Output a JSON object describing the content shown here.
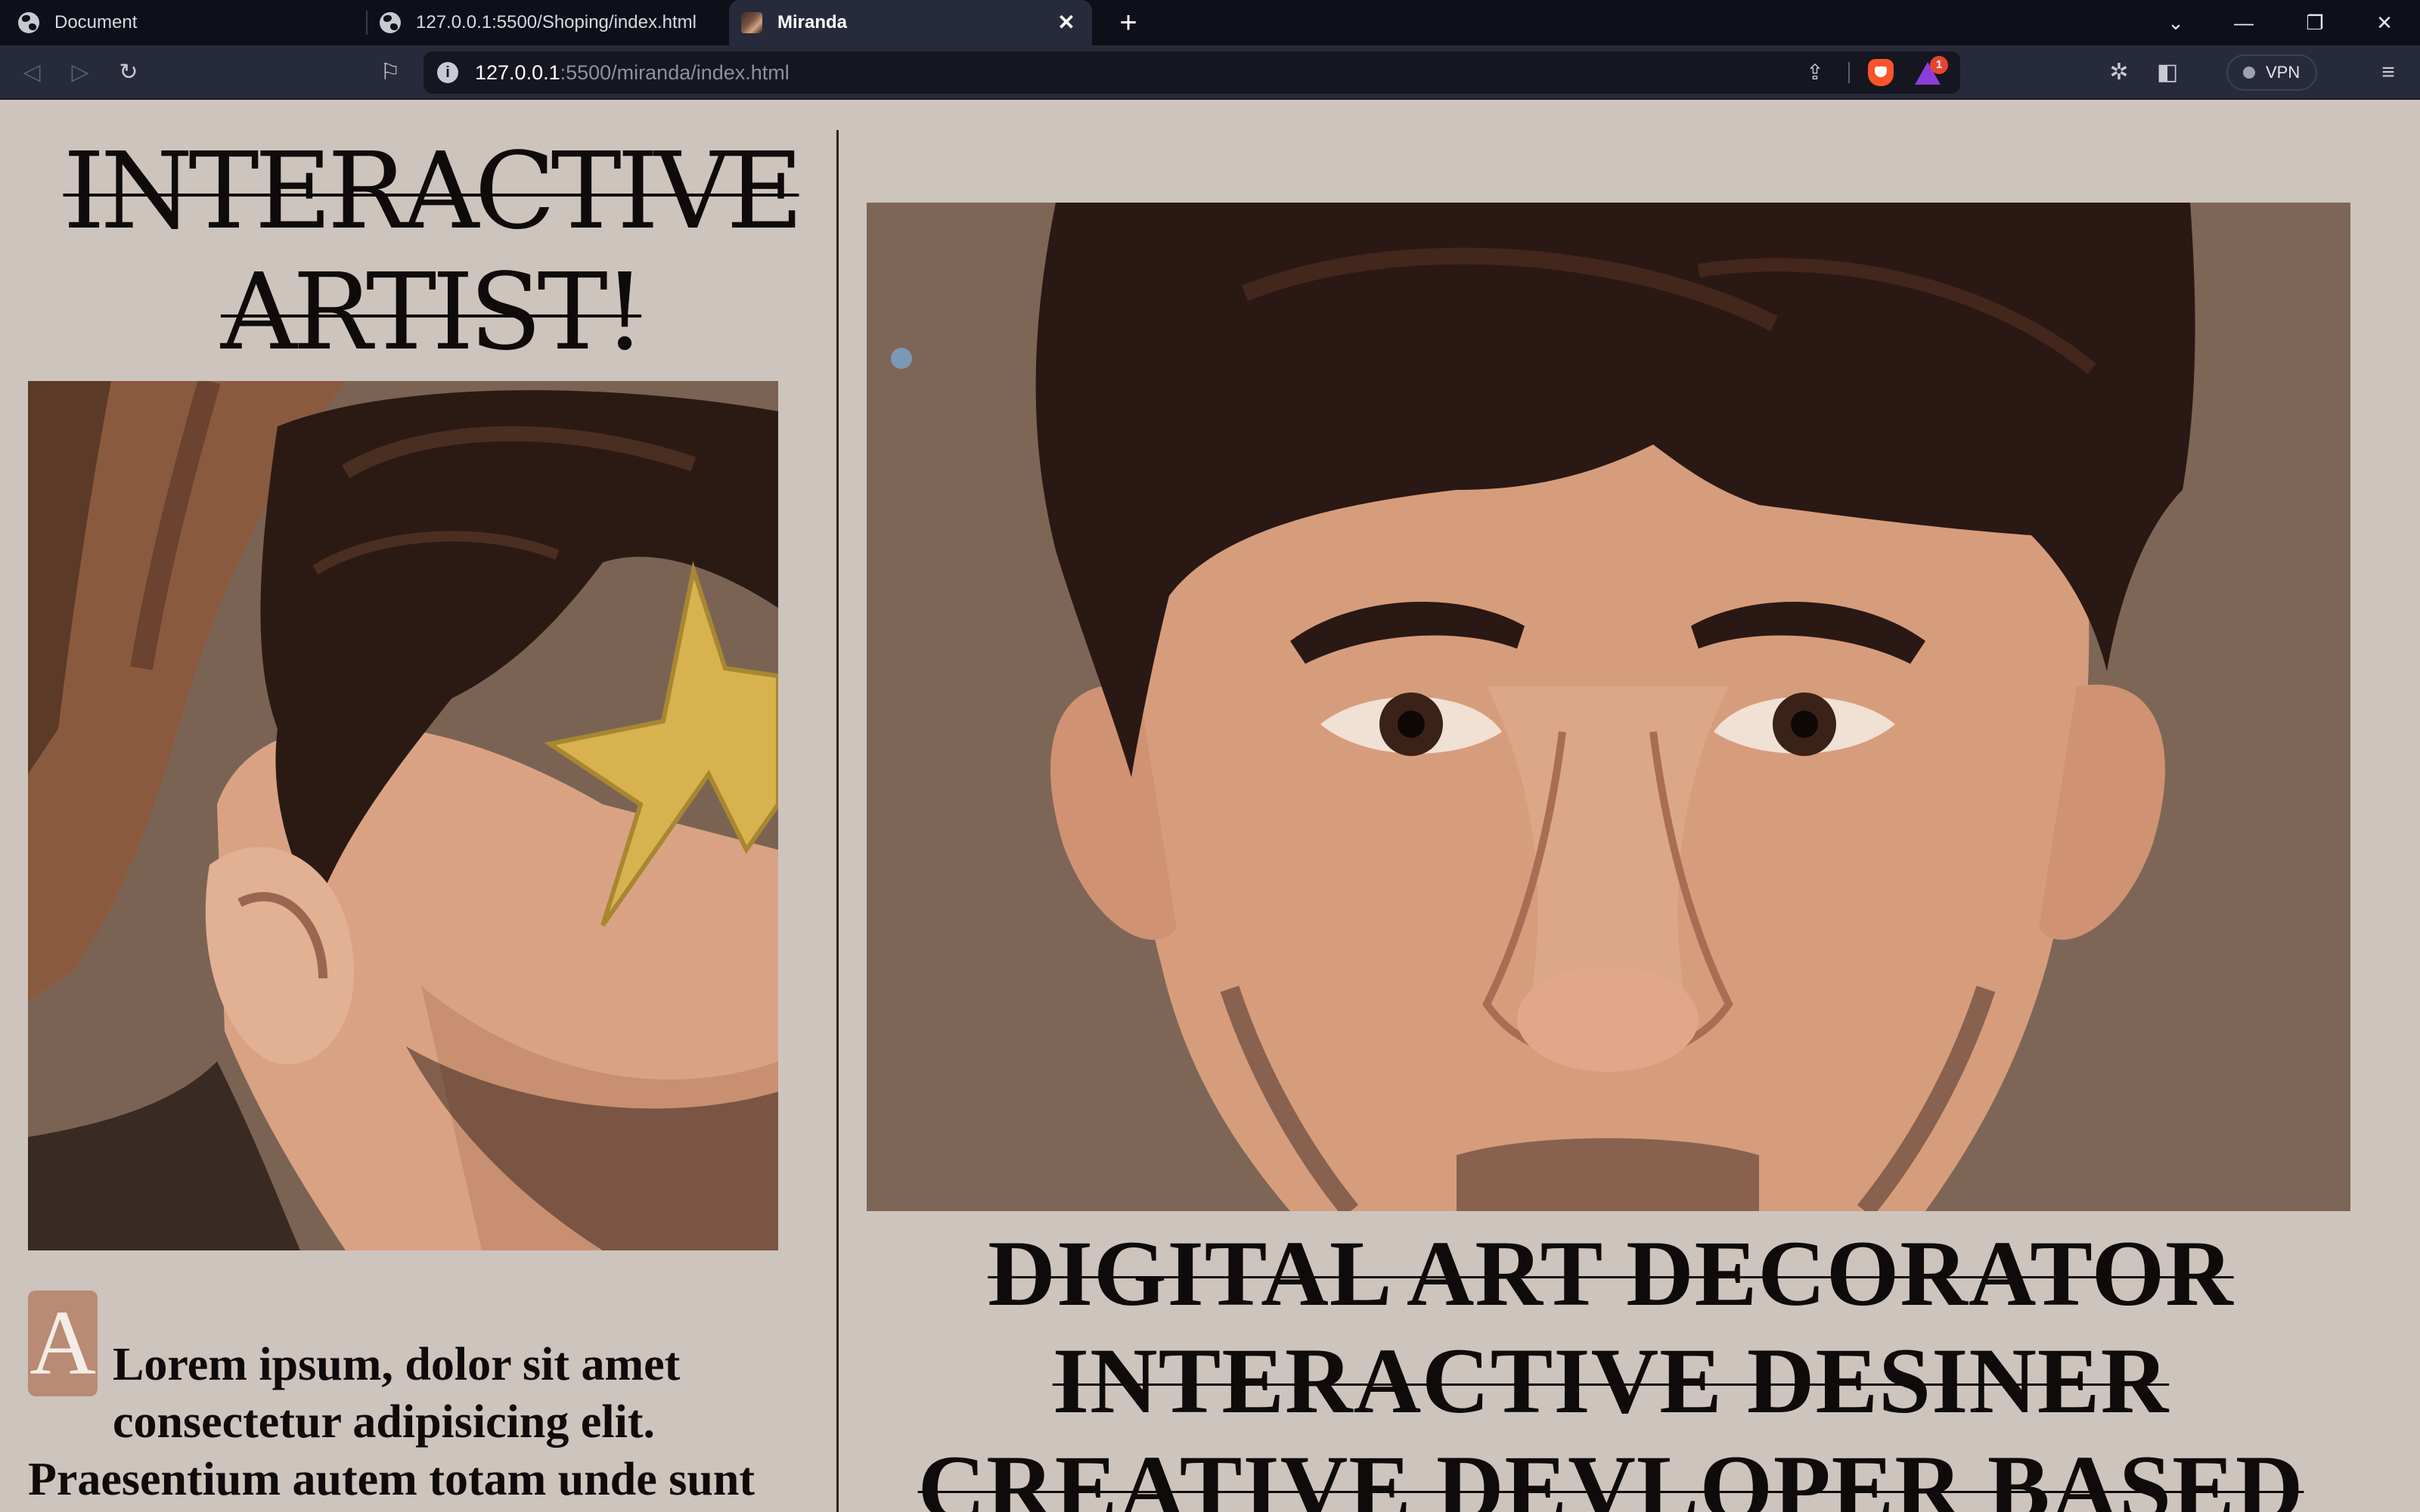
{
  "browser": {
    "tabs": [
      {
        "title": "Document",
        "active": false
      },
      {
        "title": "127.0.0.1:5500/Shoping/index.html",
        "active": false
      },
      {
        "title": "Miranda",
        "active": true
      }
    ],
    "url_host": "127.0.0.1",
    "url_rest": ":5500/miranda/index.html",
    "rewards_badge": "1",
    "vpn_label": "VPN"
  },
  "page": {
    "hero_title_line1": "INTERACTIVE",
    "hero_title_line2": "ARTIST!",
    "drop_cap": "A",
    "intro_text": "Lorem ipsum, dolor sit amet consectetur adipisicing elit. Praesentium autem totam unde sunt",
    "tagline_lines": [
      "DIGITAL ART DECORATOR",
      "INTERACTIVE DESINER",
      "CREATIVE DEVLOPER BASED"
    ]
  },
  "colors": {
    "background": "#cdc4bd",
    "text": "#0e0b0a",
    "drop_cap_bg": "#b98a74",
    "tab_strip": "#0f0f1a",
    "toolbar": "#272a3a"
  },
  "artwork": {
    "left": "illustrated portrait, side profile with hat and gold star over eye",
    "right": "illustrated portrait, frontal face close-up"
  }
}
